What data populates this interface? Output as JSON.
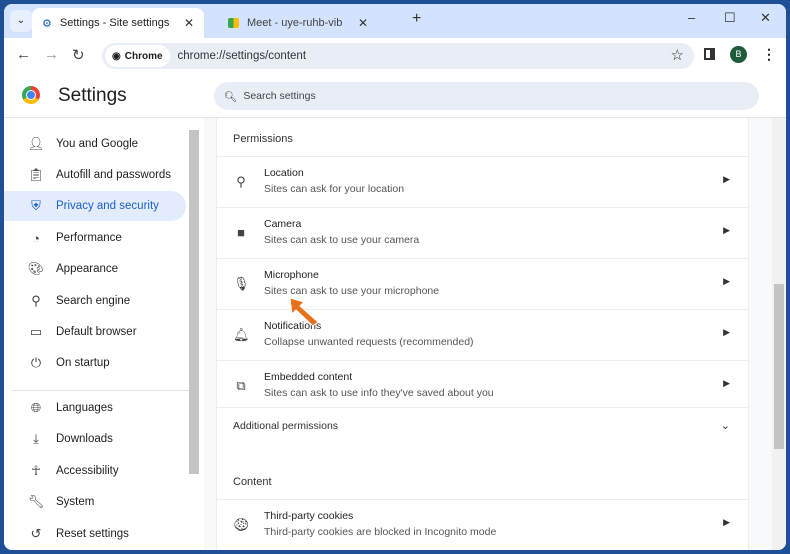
{
  "tabs": [
    {
      "label": "Settings - Site settings",
      "active": true
    },
    {
      "label": "Meet - uye-ruhb-vib",
      "active": false
    }
  ],
  "toolbar": {
    "chip": "Chrome",
    "url": "chrome://settings/content",
    "avatar": "B"
  },
  "header": {
    "title": "Settings",
    "search_placeholder": "Search settings"
  },
  "sidebar": {
    "items": [
      {
        "label": "You and Google",
        "icon": "person-icon"
      },
      {
        "label": "Autofill and passwords",
        "icon": "clipboard-icon"
      },
      {
        "label": "Privacy and security",
        "icon": "shield-icon",
        "selected": true
      },
      {
        "label": "Performance",
        "icon": "gauge-icon"
      },
      {
        "label": "Appearance",
        "icon": "palette-icon"
      },
      {
        "label": "Search engine",
        "icon": "search-icon"
      },
      {
        "label": "Default browser",
        "icon": "browser-icon"
      },
      {
        "label": "On startup",
        "icon": "power-icon"
      },
      {
        "label": "Languages",
        "icon": "globe-icon"
      },
      {
        "label": "Downloads",
        "icon": "download-icon"
      },
      {
        "label": "Accessibility",
        "icon": "accessibility-icon"
      },
      {
        "label": "System",
        "icon": "wrench-icon"
      },
      {
        "label": "Reset settings",
        "icon": "history-icon"
      }
    ]
  },
  "main": {
    "permissions_heading": "Permissions",
    "permissions": [
      {
        "title": "Location",
        "sub": "Sites can ask for your location",
        "icon": "location-pin-icon"
      },
      {
        "title": "Camera",
        "sub": "Sites can ask to use your camera",
        "icon": "camera-icon"
      },
      {
        "title": "Microphone",
        "sub": "Sites can ask to use your microphone",
        "icon": "microphone-icon"
      },
      {
        "title": "Notifications",
        "sub": "Collapse unwanted requests (recommended)",
        "icon": "bell-icon"
      },
      {
        "title": "Embedded content",
        "sub": "Sites can ask to use info they've saved about you",
        "icon": "embedded-content-icon"
      }
    ],
    "additional_permissions": "Additional permissions",
    "content_heading": "Content",
    "content": [
      {
        "title": "Third-party cookies",
        "sub": "Third-party cookies are blocked in Incognito mode",
        "icon": "cookie-icon"
      }
    ]
  },
  "colors": {
    "accent": "#1a5fd0",
    "frame": "#1f4f96",
    "arrow": "#e8701a"
  }
}
